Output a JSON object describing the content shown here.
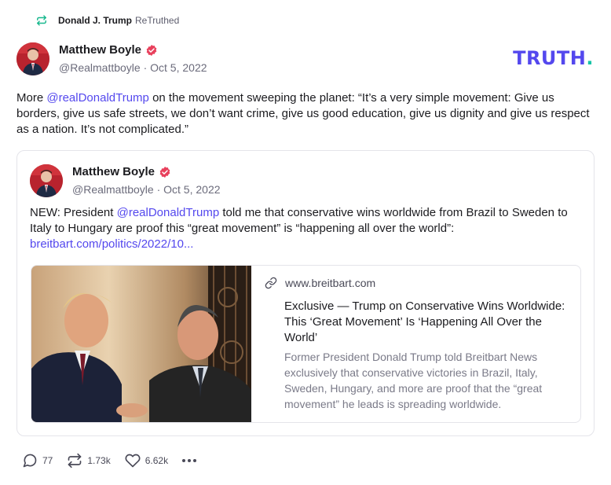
{
  "retruth": {
    "user": "Donald J. Trump",
    "action": "ReTruthed"
  },
  "post": {
    "author_name": "Matthew Boyle",
    "handle": "@Realmattboyle",
    "date": "Oct 5, 2022",
    "meta": "@Realmattboyle · Oct 5, 2022",
    "text_before": "More ",
    "mention": "@realDonaldTrump",
    "text_after": " on the movement sweeping the planet: “It’s a very simple movement: Give us borders, give us safe streets, we don’t want crime, give us good education, give us dignity and give us respect as a nation. It’s not complicated.”"
  },
  "logo": {
    "text": "TRUTH",
    "dot": "."
  },
  "quote": {
    "author_name": "Matthew Boyle",
    "meta": "@Realmattboyle · Oct 5, 2022",
    "text_before": "NEW: President ",
    "mention": "@realDonaldTrump",
    "text_after": " told me that conservative wins worldwide from Brazil to Sweden to Italy to Hungary are proof this “great movement” is “happening all over the world”: ",
    "link": "breitbart.com/politics/2022/10..."
  },
  "link_card": {
    "domain": "www.breitbart.com",
    "title": "Exclusive — Trump on Conservative Wins Worldwide: This ‘Great Movement’ Is ‘Happening All Over the World’",
    "description": "Former President Donald Trump told Breitbart News exclusively that conservative victories in Brazil, Italy, Sweden, Hungary, and more are proof that the “great movement” he leads is spreading worldwide."
  },
  "actions": {
    "replies": "77",
    "retruths": "1.73k",
    "likes": "6.62k"
  },
  "colors": {
    "accent": "#5448ee",
    "logo_dot": "#16c4a8",
    "verified": "#e8405c",
    "retruth_icon": "#19b88e"
  }
}
